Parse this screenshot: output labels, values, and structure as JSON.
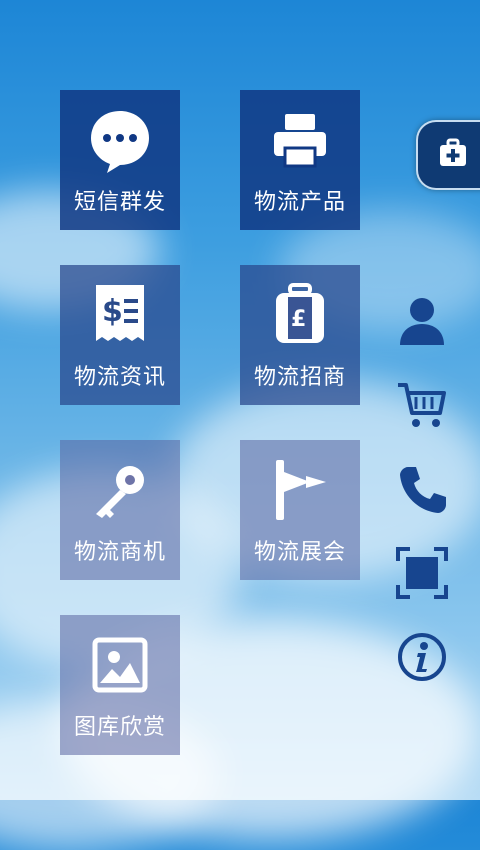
{
  "tiles": [
    {
      "label": "短信群发",
      "icon": "chat-bubble-icon"
    },
    {
      "label": "物流产品",
      "icon": "printer-icon"
    },
    {
      "label": "物流资讯",
      "icon": "receipt-icon"
    },
    {
      "label": "物流招商",
      "icon": "suitcase-pound-icon"
    },
    {
      "label": "物流商机",
      "icon": "key-icon"
    },
    {
      "label": "物流展会",
      "icon": "flag-icon"
    },
    {
      "label": "图库欣赏",
      "icon": "picture-icon"
    }
  ],
  "sidebar": {
    "tab_icon": "medical-kit-icon",
    "items": [
      {
        "icon": "user-icon"
      },
      {
        "icon": "cart-icon"
      },
      {
        "icon": "phone-icon"
      },
      {
        "icon": "fullscreen-icon"
      },
      {
        "icon": "info-icon"
      }
    ]
  },
  "colors": {
    "icon_blue": "#17458f",
    "tile_dark": "#103884",
    "sky": "#2a8ddb"
  }
}
